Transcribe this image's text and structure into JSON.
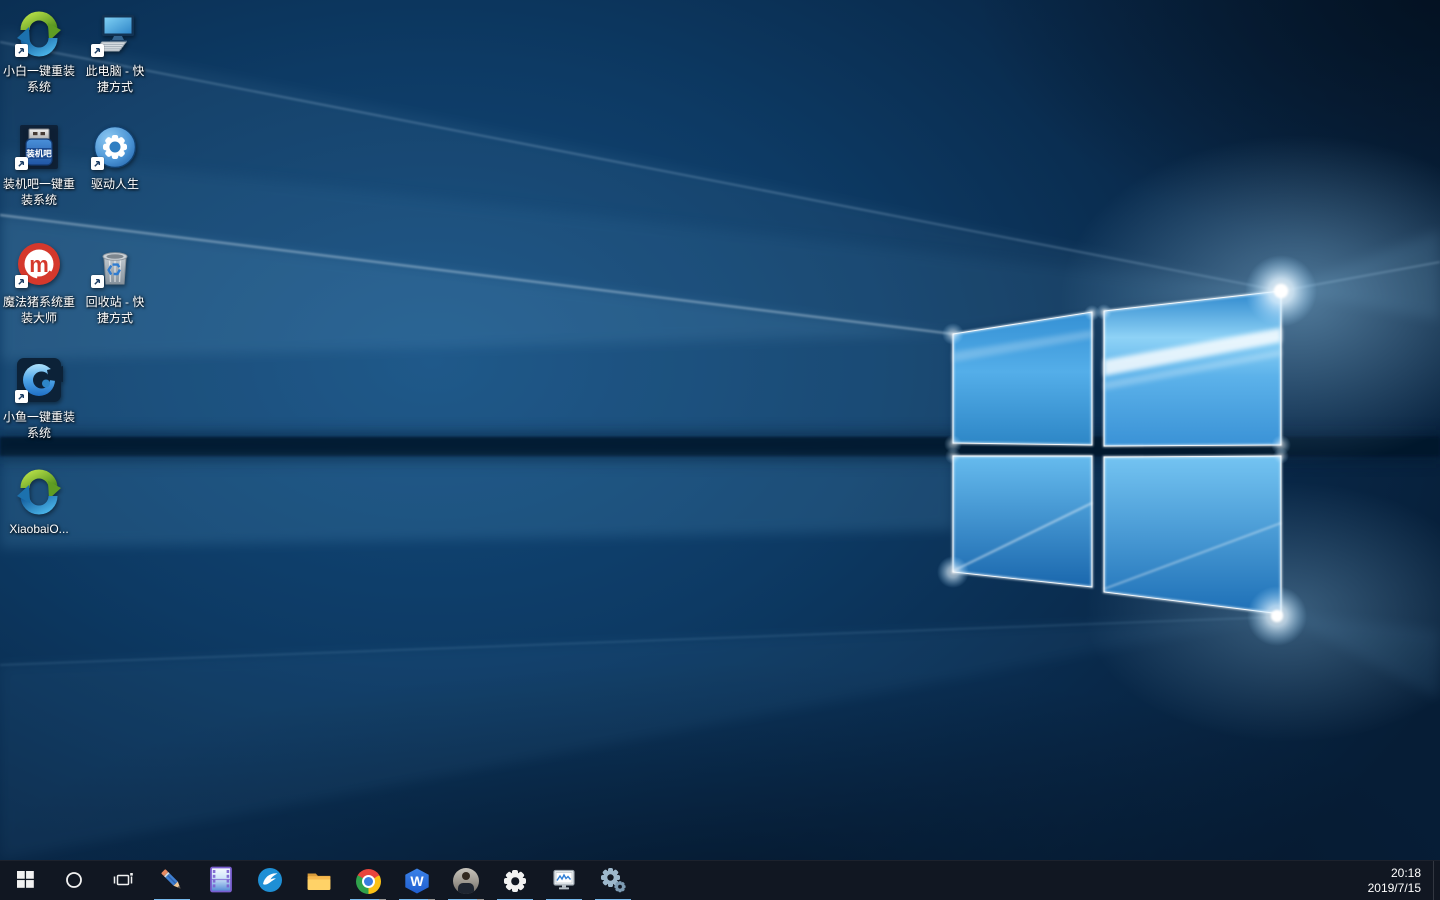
{
  "desktop": {
    "icons": [
      {
        "name": "xiaobai-one-key-reinstall",
        "label": "小白一键重装\n系统",
        "shortcut": true
      },
      {
        "name": "this-pc",
        "label": "此电脑 - 快\n捷方式",
        "shortcut": true
      },
      {
        "name": "zhuangjiba-one-key-reinstall",
        "label": "装机吧一键重\n装系统",
        "shortcut": true,
        "badge_text": "装机吧"
      },
      {
        "name": "driver-life",
        "label": "驱动人生",
        "shortcut": true
      },
      {
        "name": "magic-pig-reinstall-master",
        "label": "魔法猪系统重\n装大师",
        "shortcut": true,
        "logo_letter": "m"
      },
      {
        "name": "recycle-bin",
        "label": "回收站 - 快\n捷方式",
        "shortcut": true
      },
      {
        "name": "xiaoyu-one-key-reinstall",
        "label": "小鱼一键重装\n系统",
        "shortcut": true
      },
      {
        "name": "xiaobai-installer",
        "label": "XiaobaiO...",
        "shortcut": false
      }
    ]
  },
  "taskbar": {
    "buttons": [
      {
        "name": "start",
        "running": false,
        "grouped": false
      },
      {
        "name": "search",
        "running": false,
        "grouped": false
      },
      {
        "name": "task-view",
        "running": false,
        "grouped": false
      },
      {
        "name": "pencil-app",
        "running": true,
        "grouped": false
      },
      {
        "name": "video-app",
        "running": false,
        "grouped": false
      },
      {
        "name": "wing-app",
        "running": false,
        "grouped": false
      },
      {
        "name": "file-explorer",
        "running": false,
        "grouped": false
      },
      {
        "name": "chrome",
        "running": true,
        "grouped": true
      },
      {
        "name": "wps-office",
        "running": true,
        "grouped": true,
        "letter": "W"
      },
      {
        "name": "user-account-app",
        "running": true,
        "grouped": true
      },
      {
        "name": "settings",
        "running": true,
        "grouped": false
      },
      {
        "name": "task-manager",
        "running": true,
        "grouped": false
      },
      {
        "name": "services",
        "running": true,
        "grouped": false
      }
    ],
    "clock": {
      "time": "20:18",
      "date": "2019/7/15"
    },
    "colors": {
      "underline": "#76b9ed",
      "underline_grouped_tip": "#9a9a9a",
      "background": "#111722"
    }
  },
  "wallpaper": {
    "base": "#0b2b4a",
    "accent": "#2f8fd8"
  }
}
